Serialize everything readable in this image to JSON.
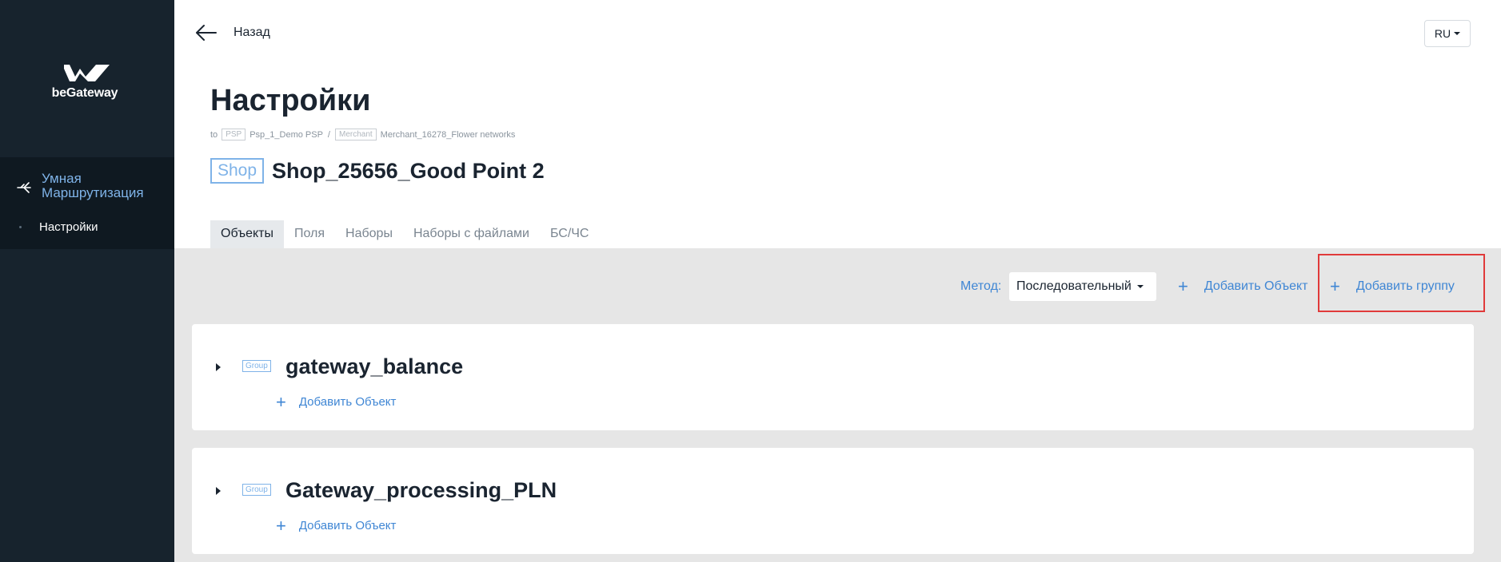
{
  "sidebar": {
    "logo_text": "beGateway",
    "nav_main_label": "Умная Маршрутизация",
    "nav_sub_label": "Настройки"
  },
  "topbar": {
    "back_label": "Назад",
    "lang_label": "RU"
  },
  "header": {
    "title": "Настройки",
    "breadcrumb": {
      "prefix": "to",
      "psp_tag": "PSP",
      "psp_name": "Psp_1_Demo PSP",
      "separator": "/",
      "merchant_tag": "Merchant",
      "merchant_name": "Merchant_16278_Flower networks"
    },
    "shop_badge": "Shop",
    "shop_name": "Shop_25656_Good Point 2"
  },
  "tabs": [
    {
      "label": "Объекты",
      "active": true
    },
    {
      "label": "Поля",
      "active": false
    },
    {
      "label": "Наборы",
      "active": false
    },
    {
      "label": "Наборы с файлами",
      "active": false
    },
    {
      "label": "БС/ЧС",
      "active": false
    }
  ],
  "toolbar": {
    "method_label": "Метод:",
    "method_value": "Последовательный",
    "add_object_label": "Добавить Объект",
    "add_group_label": "Добавить группу"
  },
  "groups": [
    {
      "badge": "Group",
      "name": "gateway_balance",
      "add_object_label": "Добавить Объект"
    },
    {
      "badge": "Group",
      "name": "Gateway_processing_PLN",
      "add_object_label": "Добавить Объект"
    }
  ],
  "colors": {
    "sidebar_bg": "#17232d",
    "accent": "#3f86d4",
    "highlight": "#e03a3a"
  }
}
